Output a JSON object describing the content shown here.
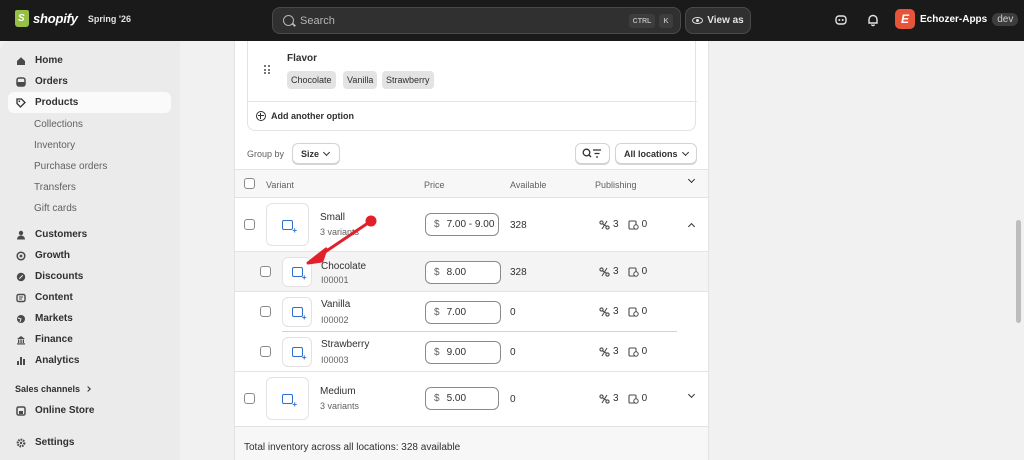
{
  "topbar": {
    "brand": "shopify",
    "version": "Spring '26",
    "search_placeholder": "Search",
    "search_kbd_1": "CTRL",
    "search_kbd_2": "K",
    "view_as": "View as",
    "store_initial": "E",
    "store_name": "Echozer-Apps",
    "store_env": "dev"
  },
  "sidebar": {
    "items": [
      {
        "label": "Home",
        "icon": "home-icon"
      },
      {
        "label": "Orders",
        "icon": "orders-icon"
      },
      {
        "label": "Products",
        "icon": "tag-icon"
      }
    ],
    "product_subitems": [
      "Collections",
      "Inventory",
      "Purchase orders",
      "Transfers",
      "Gift cards"
    ],
    "items2": [
      {
        "label": "Customers",
        "icon": "person-icon"
      },
      {
        "label": "Growth",
        "icon": "growth-icon"
      },
      {
        "label": "Discounts",
        "icon": "discount-icon"
      },
      {
        "label": "Content",
        "icon": "content-icon"
      },
      {
        "label": "Markets",
        "icon": "globe-icon"
      },
      {
        "label": "Finance",
        "icon": "bank-icon"
      },
      {
        "label": "Analytics",
        "icon": "chart-icon"
      }
    ],
    "sales_channels": "Sales channels",
    "online_store": "Online Store",
    "settings": "Settings"
  },
  "options": {
    "name": "Flavor",
    "values": [
      "Chocolate",
      "Vanilla",
      "Strawberry"
    ],
    "add_another": "Add another option"
  },
  "toolbar": {
    "group_by_label": "Group by",
    "group_by_value": "Size",
    "locations": "All locations"
  },
  "table": {
    "headers": {
      "variant": "Variant",
      "price": "Price",
      "available": "Available",
      "publishing": "Publishing"
    },
    "groups": [
      {
        "name": "Small",
        "sub": "3 variants",
        "price": "7.00 - 9.00",
        "available": "328",
        "channels": "3",
        "catalogs": "0",
        "variants": [
          {
            "name": "Chocolate",
            "sku": "I00001",
            "price": "8.00",
            "available": "328",
            "channels": "3",
            "catalogs": "0"
          },
          {
            "name": "Vanilla",
            "sku": "I00002",
            "price": "7.00",
            "available": "0",
            "channels": "3",
            "catalogs": "0"
          },
          {
            "name": "Strawberry",
            "sku": "I00003",
            "price": "9.00",
            "available": "0",
            "channels": "3",
            "catalogs": "0"
          }
        ]
      },
      {
        "name": "Medium",
        "sub": "3 variants",
        "price": "5.00",
        "available": "0",
        "channels": "3",
        "catalogs": "0"
      }
    ],
    "currency": "$",
    "footer": "Total inventory across all locations: 328 available"
  },
  "colors": {
    "accent": "#2c6ecb",
    "annotation_arrow": "#e0202a"
  }
}
